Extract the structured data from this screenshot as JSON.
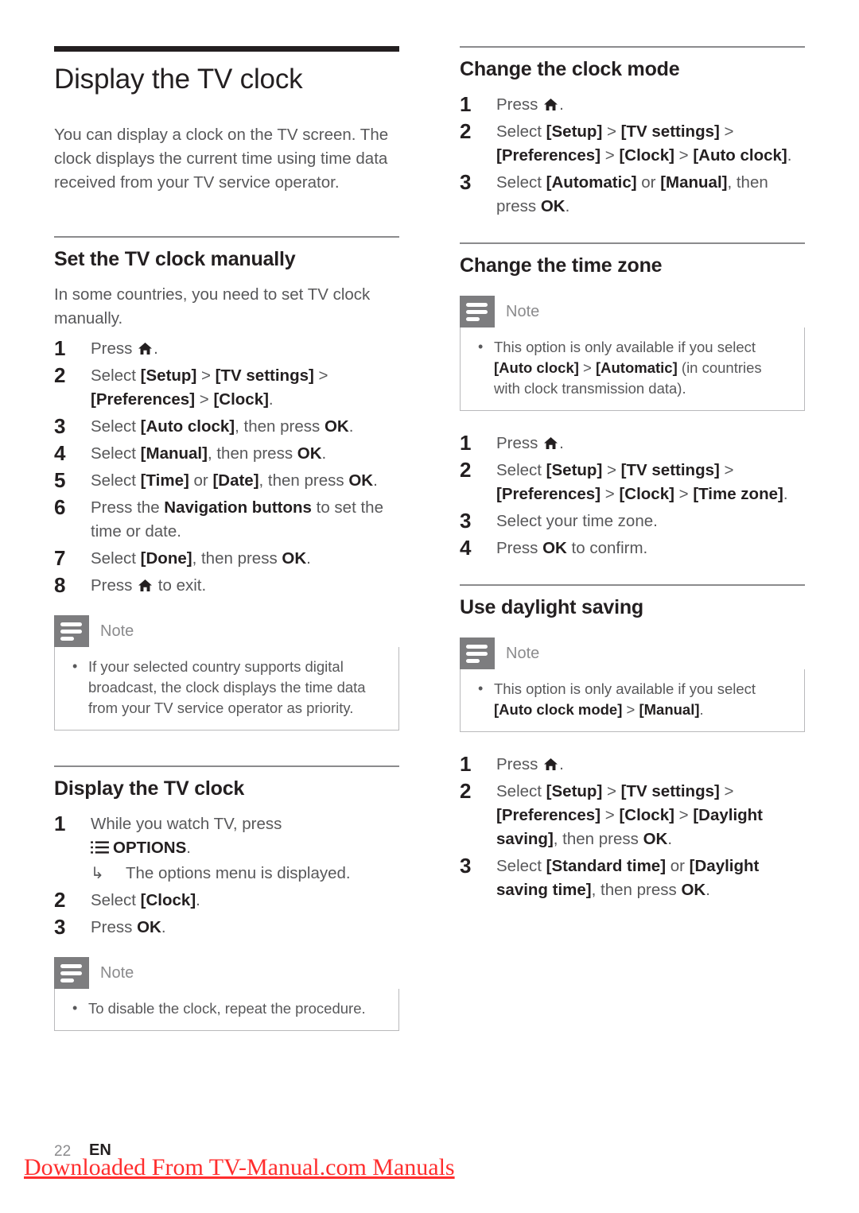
{
  "document": {
    "title": "Display the TV clock",
    "intro": "You can display a clock on the TV screen. The clock displays the current time using time data received from your TV service operator."
  },
  "icons": {
    "home": "home-icon",
    "options": "options-list-icon",
    "note": "note-icon",
    "arrow": "↳",
    "bullet": "•"
  },
  "left_column": {
    "section_manual": {
      "heading": "Set the TV clock manually",
      "intro": "In some countries, you need to set TV clock manually.",
      "steps": [
        {
          "num": "1",
          "parts": [
            {
              "t": "Press "
            },
            {
              "icon": "home"
            },
            {
              "t": "."
            }
          ]
        },
        {
          "num": "2",
          "parts": [
            {
              "t": "Select "
            },
            {
              "b": "[Setup]"
            },
            {
              "t": " "
            },
            {
              "gt": ">"
            },
            {
              "t": " "
            },
            {
              "b": "[TV settings]"
            },
            {
              "t": " "
            },
            {
              "gt": ">"
            },
            {
              "t": " "
            },
            {
              "b": "[Preferences]"
            },
            {
              "t": " "
            },
            {
              "gt": ">"
            },
            {
              "t": " "
            },
            {
              "b": "[Clock]"
            },
            {
              "t": "."
            }
          ]
        },
        {
          "num": "3",
          "parts": [
            {
              "t": "Select "
            },
            {
              "b": "[Auto clock]"
            },
            {
              "t": ", then press "
            },
            {
              "b": "OK"
            },
            {
              "t": "."
            }
          ]
        },
        {
          "num": "4",
          "parts": [
            {
              "t": "Select "
            },
            {
              "b": "[Manual]"
            },
            {
              "t": ", then press "
            },
            {
              "b": "OK"
            },
            {
              "t": "."
            }
          ]
        },
        {
          "num": "5",
          "parts": [
            {
              "t": "Select "
            },
            {
              "b": "[Time]"
            },
            {
              "t": " or "
            },
            {
              "b": "[Date]"
            },
            {
              "t": ", then press "
            },
            {
              "b": "OK"
            },
            {
              "t": "."
            }
          ]
        },
        {
          "num": "6",
          "parts": [
            {
              "t": "Press the "
            },
            {
              "b": "Navigation buttons"
            },
            {
              "t": " to set the time or date."
            }
          ]
        },
        {
          "num": "7",
          "parts": [
            {
              "t": "Select "
            },
            {
              "b": "[Done]"
            },
            {
              "t": ", then press "
            },
            {
              "b": "OK"
            },
            {
              "t": "."
            }
          ]
        },
        {
          "num": "8",
          "parts": [
            {
              "t": "Press "
            },
            {
              "icon": "home"
            },
            {
              "t": " to exit."
            }
          ]
        }
      ],
      "note": {
        "label": "Note",
        "items": [
          "If your selected country supports digital broadcast, the clock displays the time data from your TV service operator as priority."
        ]
      }
    },
    "section_display": {
      "heading": "Display the TV clock",
      "steps": [
        {
          "num": "1",
          "parts": [
            {
              "t": "While you watch TV, press "
            },
            {
              "br": true
            },
            {
              "icon": "options"
            },
            {
              "b": "OPTIONS"
            },
            {
              "t": "."
            }
          ],
          "subresult": "The options menu is displayed."
        },
        {
          "num": "2",
          "parts": [
            {
              "t": "Select "
            },
            {
              "b": "[Clock]"
            },
            {
              "t": "."
            }
          ]
        },
        {
          "num": "3",
          "parts": [
            {
              "t": "Press "
            },
            {
              "b": "OK"
            },
            {
              "t": "."
            }
          ]
        }
      ],
      "note": {
        "label": "Note",
        "items": [
          "To disable the clock, repeat the procedure."
        ]
      }
    }
  },
  "right_column": {
    "section_clock_mode": {
      "heading": "Change the clock mode",
      "steps": [
        {
          "num": "1",
          "parts": [
            {
              "t": "Press "
            },
            {
              "icon": "home"
            },
            {
              "t": "."
            }
          ]
        },
        {
          "num": "2",
          "parts": [
            {
              "t": "Select "
            },
            {
              "b": "[Setup]"
            },
            {
              "t": " "
            },
            {
              "gt": ">"
            },
            {
              "t": " "
            },
            {
              "b": "[TV settings]"
            },
            {
              "t": " "
            },
            {
              "gt": ">"
            },
            {
              "t": " "
            },
            {
              "b": "[Preferences]"
            },
            {
              "t": " "
            },
            {
              "gt": ">"
            },
            {
              "t": " "
            },
            {
              "b": "[Clock]"
            },
            {
              "t": " "
            },
            {
              "gt": ">"
            },
            {
              "t": " "
            },
            {
              "b": "[Auto clock]"
            },
            {
              "t": "."
            }
          ]
        },
        {
          "num": "3",
          "parts": [
            {
              "t": "Select "
            },
            {
              "b": "[Automatic]"
            },
            {
              "t": " or "
            },
            {
              "b": "[Manual]"
            },
            {
              "t": ", then press "
            },
            {
              "b": "OK"
            },
            {
              "t": "."
            }
          ]
        }
      ]
    },
    "section_time_zone": {
      "heading": "Change the time zone",
      "note": {
        "label": "Note",
        "items_rich": [
          [
            {
              "t": "This option is only available if you select "
            },
            {
              "b": "[Auto clock]"
            },
            {
              "t": " "
            },
            {
              "gt": ">"
            },
            {
              "t": " "
            },
            {
              "b": "[Automatic]"
            },
            {
              "t": " (in countries with clock transmission data)."
            }
          ]
        ]
      },
      "steps": [
        {
          "num": "1",
          "parts": [
            {
              "t": "Press "
            },
            {
              "icon": "home"
            },
            {
              "t": "."
            }
          ]
        },
        {
          "num": "2",
          "parts": [
            {
              "t": "Select "
            },
            {
              "b": "[Setup]"
            },
            {
              "t": " "
            },
            {
              "gt": ">"
            },
            {
              "t": " "
            },
            {
              "b": "[TV settings]"
            },
            {
              "t": " "
            },
            {
              "gt": ">"
            },
            {
              "t": " "
            },
            {
              "b": "[Preferences]"
            },
            {
              "t": " "
            },
            {
              "gt": ">"
            },
            {
              "t": " "
            },
            {
              "b": "[Clock]"
            },
            {
              "t": " "
            },
            {
              "gt": ">"
            },
            {
              "t": " "
            },
            {
              "b": "[Time zone]"
            },
            {
              "t": "."
            }
          ]
        },
        {
          "num": "3",
          "parts": [
            {
              "t": "Select your time zone."
            }
          ]
        },
        {
          "num": "4",
          "parts": [
            {
              "t": "Press "
            },
            {
              "b": "OK"
            },
            {
              "t": " to confirm."
            }
          ]
        }
      ]
    },
    "section_daylight": {
      "heading": "Use daylight saving",
      "note": {
        "label": "Note",
        "items_rich": [
          [
            {
              "t": "This option is only available if you select "
            },
            {
              "b": "[Auto clock mode]"
            },
            {
              "t": " "
            },
            {
              "gt": ">"
            },
            {
              "t": " "
            },
            {
              "b": "[Manual]"
            },
            {
              "t": "."
            }
          ]
        ]
      },
      "steps": [
        {
          "num": "1",
          "parts": [
            {
              "t": "Press "
            },
            {
              "icon": "home"
            },
            {
              "t": "."
            }
          ]
        },
        {
          "num": "2",
          "parts": [
            {
              "t": "Select "
            },
            {
              "b": "[Setup]"
            },
            {
              "t": " "
            },
            {
              "gt": ">"
            },
            {
              "t": " "
            },
            {
              "b": "[TV settings]"
            },
            {
              "t": " "
            },
            {
              "gt": ">"
            },
            {
              "t": " "
            },
            {
              "b": "[Preferences]"
            },
            {
              "t": " "
            },
            {
              "gt": ">"
            },
            {
              "t": " "
            },
            {
              "b": "[Clock]"
            },
            {
              "t": " "
            },
            {
              "gt": ">"
            },
            {
              "t": " "
            },
            {
              "b": "[Daylight saving]"
            },
            {
              "t": ", then press "
            },
            {
              "b": "OK"
            },
            {
              "t": "."
            }
          ]
        },
        {
          "num": "3",
          "parts": [
            {
              "t": "Select "
            },
            {
              "b": "[Standard time]"
            },
            {
              "t": " or "
            },
            {
              "b": "[Daylight saving time]"
            },
            {
              "t": ", then press "
            },
            {
              "b": "OK"
            },
            {
              "t": "."
            }
          ]
        }
      ]
    }
  },
  "footer": {
    "page_number": "22",
    "language": "EN",
    "watermark": "Downloaded From TV-Manual.com Manuals"
  }
}
